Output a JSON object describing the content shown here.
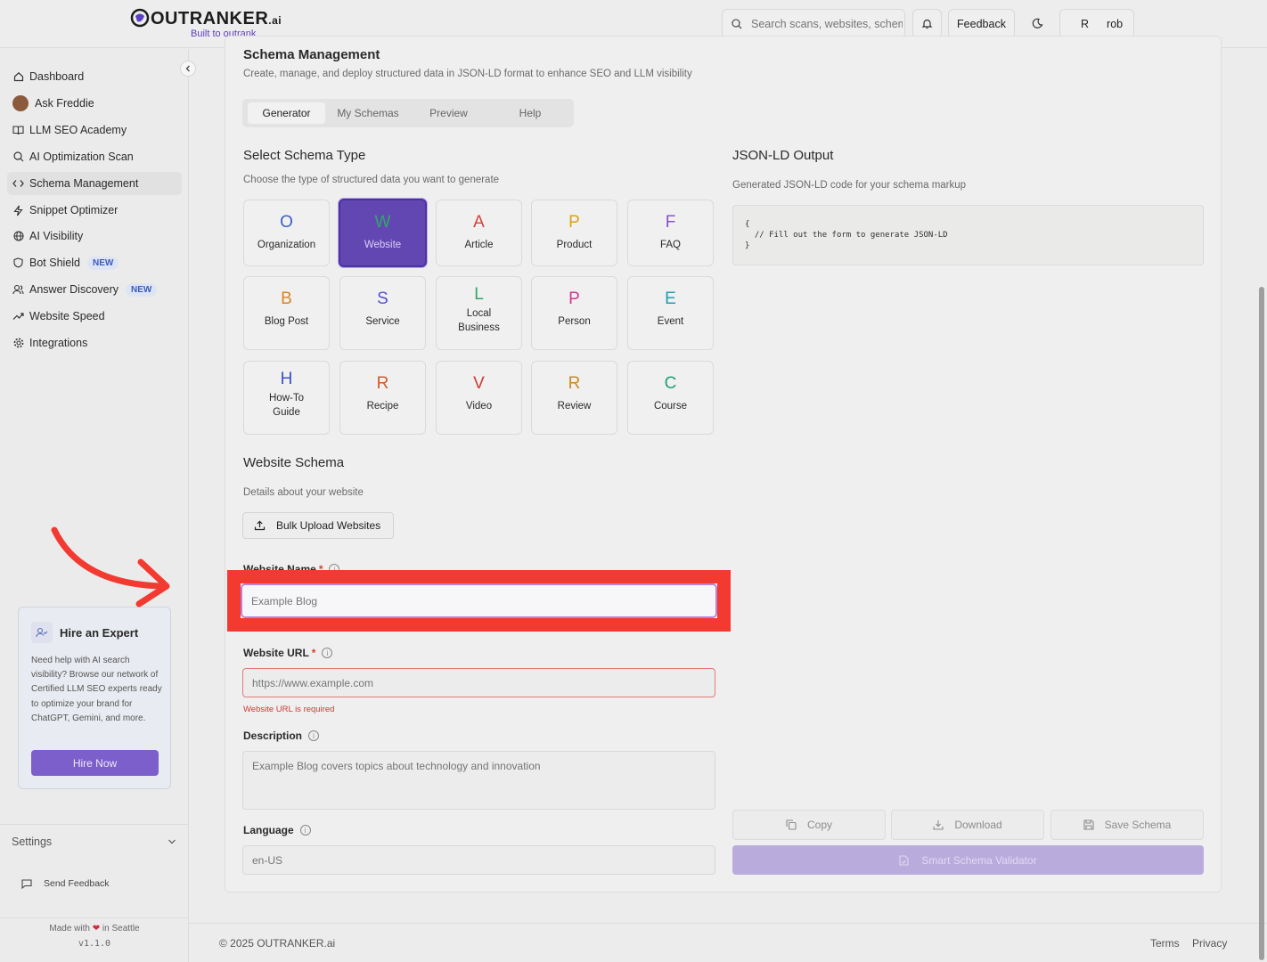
{
  "header": {
    "logo_text": "OUTRANKER",
    "logo_tld": ".ai",
    "logo_tagline": "Built to outrank",
    "search_placeholder": "Search scans, websites, schemas",
    "feedback_label": "Feedback",
    "user_initial": "R",
    "user_name": "rob"
  },
  "sidebar": {
    "items": [
      {
        "label": "Dashboard",
        "icon": "home-icon"
      },
      {
        "label": "Ask Freddie",
        "icon": "avatar"
      },
      {
        "label": "LLM SEO Academy",
        "icon": "book-icon"
      },
      {
        "label": "AI Optimization Scan",
        "icon": "search-icon"
      },
      {
        "label": "Schema Management",
        "icon": "code-icon"
      },
      {
        "label": "Snippet Optimizer",
        "icon": "bolt-icon"
      },
      {
        "label": "AI Visibility",
        "icon": "globe-icon"
      },
      {
        "label": "Bot Shield",
        "icon": "shield-icon",
        "badge": "NEW"
      },
      {
        "label": "Answer Discovery",
        "icon": "users-icon",
        "badge": "NEW"
      },
      {
        "label": "Website Speed",
        "icon": "trend-icon"
      },
      {
        "label": "Integrations",
        "icon": "gear-icon"
      }
    ],
    "expert": {
      "title": "Hire an Expert",
      "text": "Need help with AI search visibility? Browse our network of Certified LLM SEO experts ready to optimize your brand for ChatGPT, Gemini, and more.",
      "button": "Hire Now"
    },
    "settings_label": "Settings",
    "send_feedback_label": "Send Feedback",
    "made_with_prefix": "Made with",
    "made_with_suffix": "in Seattle",
    "version": "v1.1.0"
  },
  "page": {
    "title": "Schema Management",
    "subtitle": "Create, manage, and deploy structured data in JSON-LD format to enhance SEO and LLM visibility",
    "tabs": [
      "Generator",
      "My Schemas",
      "Preview",
      "Help"
    ],
    "active_tab": "Generator"
  },
  "schema_types": {
    "title": "Select Schema Type",
    "subtitle": "Choose the type of structured data you want to generate",
    "selected": "Website",
    "items": [
      {
        "letter": "O",
        "label": "Organization",
        "color": "#3a5fc8"
      },
      {
        "letter": "W",
        "label": "Website",
        "color": "#2fa866"
      },
      {
        "letter": "A",
        "label": "Article",
        "color": "#d2413a"
      },
      {
        "letter": "P",
        "label": "Product",
        "color": "#d9a21c"
      },
      {
        "letter": "F",
        "label": "FAQ",
        "color": "#8a4fd0"
      },
      {
        "letter": "B",
        "label": "Blog Post",
        "color": "#d98420"
      },
      {
        "letter": "S",
        "label": "Service",
        "color": "#5a4fd0"
      },
      {
        "letter": "L",
        "label": "Local Business",
        "color": "#2fa866"
      },
      {
        "letter": "P",
        "label": "Person",
        "color": "#d03a8a"
      },
      {
        "letter": "E",
        "label": "Event",
        "color": "#1f9fae"
      },
      {
        "letter": "H",
        "label": "How-To Guide",
        "color": "#3a4fc8"
      },
      {
        "letter": "R",
        "label": "Recipe",
        "color": "#d05a2a"
      },
      {
        "letter": "V",
        "label": "Video",
        "color": "#d03a3a"
      },
      {
        "letter": "R",
        "label": "Review",
        "color": "#c98a20"
      },
      {
        "letter": "C",
        "label": "Course",
        "color": "#1f9f7a"
      }
    ]
  },
  "output": {
    "title": "JSON-LD Output",
    "subtitle": "Generated JSON-LD code for your schema markup",
    "code": "{\n  // Fill out the form to generate JSON-LD\n}",
    "copy_label": "Copy",
    "download_label": "Download",
    "save_label": "Save Schema",
    "validator_label": "Smart Schema Validator"
  },
  "form": {
    "title": "Website Schema",
    "subtitle": "Details about your website",
    "bulk_upload_label": "Bulk Upload Websites",
    "website_name_label": "Website Name",
    "website_name_placeholder": "Example Blog",
    "website_url_label": "Website URL",
    "website_url_placeholder": "https://www.example.com",
    "website_url_error": "Website URL is required",
    "description_label": "Description",
    "description_placeholder": "Example Blog covers topics about technology and innovation",
    "language_label": "Language",
    "language_placeholder": "en-US",
    "required_mark": "*"
  },
  "footer": {
    "copyright": "© 2025 OUTRANKER.ai",
    "terms": "Terms",
    "privacy": "Privacy"
  },
  "colors": {
    "accent": "#6247b3",
    "highlight": "#f33a31",
    "error": "#cc3a35"
  }
}
